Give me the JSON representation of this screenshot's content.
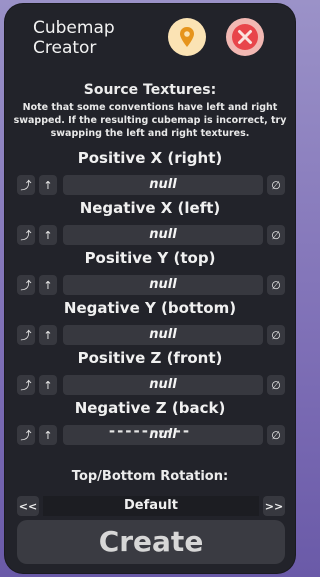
{
  "app": {
    "title_line1": "Cubemap",
    "title_line2": "Creator"
  },
  "header_buttons": {
    "pin_icon": "map-pin-icon",
    "close_icon": "close-icon"
  },
  "source": {
    "section_title": "Source Textures:",
    "note": "Note that some conventions have left and right swapped. If the resulting cubemap is incorrect, try swapping the left and right textures.",
    "faces": [
      {
        "label": "Positive X (right)",
        "value": "null"
      },
      {
        "label": "Negative X (left)",
        "value": "null"
      },
      {
        "label": "Positive Y (top)",
        "value": "null"
      },
      {
        "label": "Negative Y (bottom)",
        "value": "null"
      },
      {
        "label": "Positive Z (front)",
        "value": "null"
      },
      {
        "label": "Negative Z (back)",
        "value": "null"
      }
    ],
    "row_button_a": "⤴",
    "row_button_b": "↑",
    "row_button_clear": "∅"
  },
  "divider": "----------",
  "rotation": {
    "label": "Top/Bottom Rotation:",
    "value": "Default",
    "prev_label": "<<",
    "next_label": ">>"
  },
  "create_label": "Create",
  "colors": {
    "panel": "#22232a",
    "field": "#37383f",
    "pin_button": "#fbe3b4",
    "close_button": "#f2b8b3",
    "pin_accent": "#e6941c",
    "close_accent": "#e8454b"
  }
}
